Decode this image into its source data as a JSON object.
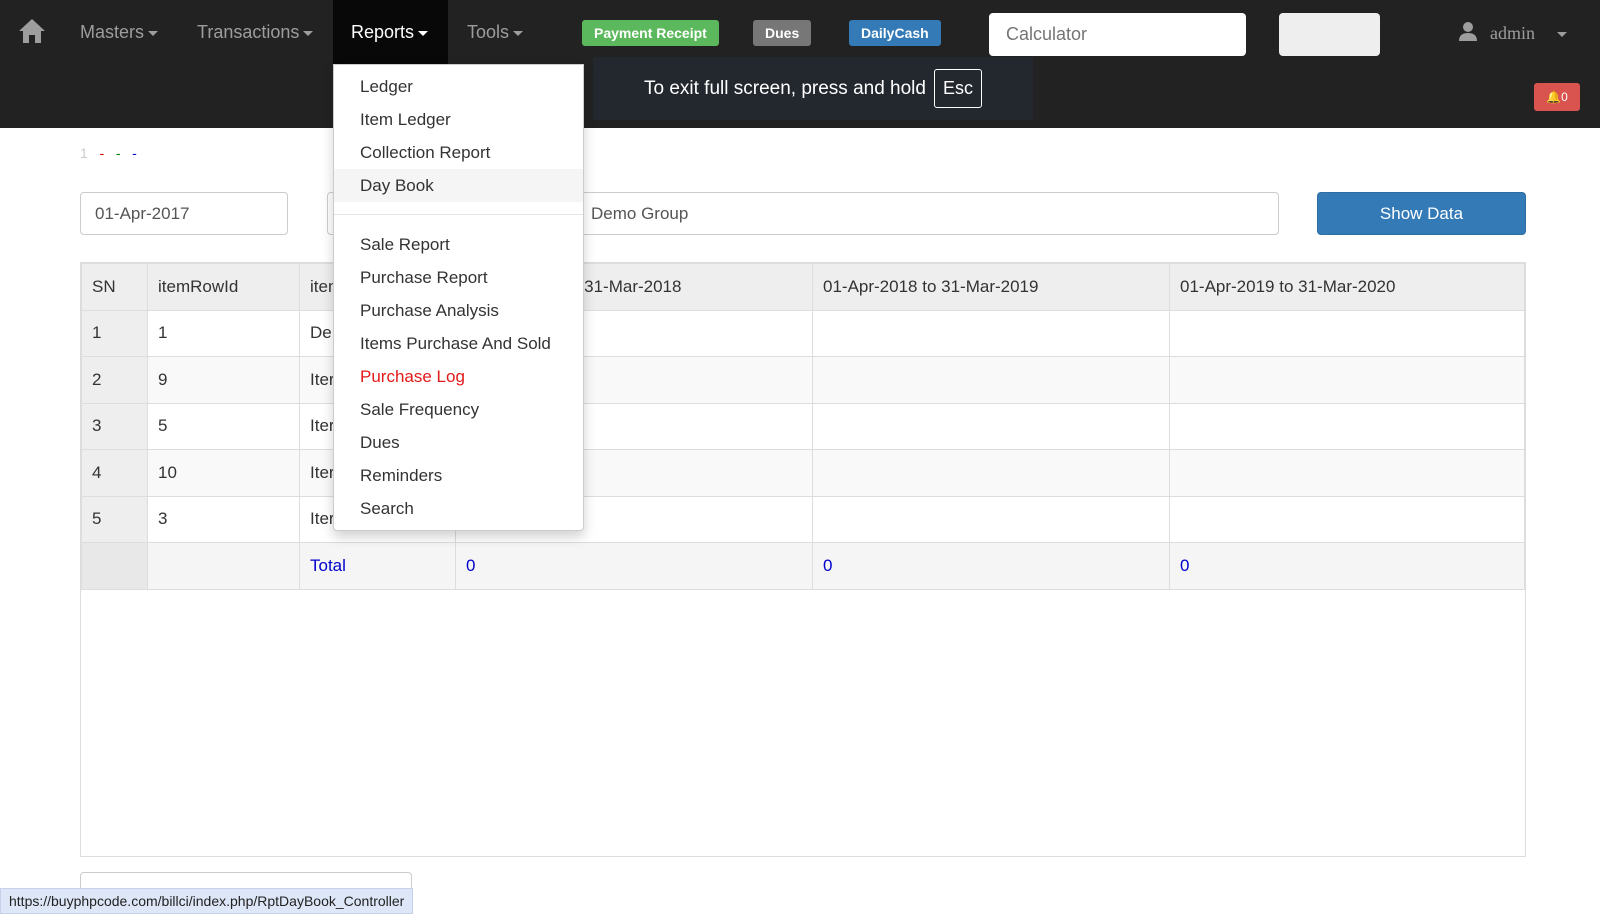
{
  "navbar": {
    "menus": [
      "Masters",
      "Transactions",
      "Reports",
      "Tools"
    ],
    "active": "Reports",
    "labels": [
      {
        "text": "Payment Receipt",
        "color": "#5cb85c"
      },
      {
        "text": "Dues",
        "color": "#777777"
      },
      {
        "text": "DailyCash",
        "color": "#337ab7"
      }
    ],
    "calculator_placeholder": "Calculator",
    "user": "admin",
    "notifications": "0"
  },
  "fullscreen_toast": {
    "text": "To exit full screen, press and hold",
    "key": "Esc"
  },
  "legend": {
    "num": "1",
    "dashes": [
      {
        "text": "-",
        "color": "#d00000"
      },
      {
        "text": "-",
        "color": "#008000"
      },
      {
        "text": "-",
        "color": "#0000cc"
      }
    ]
  },
  "filters": {
    "date": "01-Apr-2017",
    "group": "Demo Group",
    "show_button": "Show Data"
  },
  "reports_menu": {
    "group1": [
      "Ledger",
      "Item Ledger",
      "Collection Report",
      "Day Book"
    ],
    "group2": [
      "Sale Report",
      "Purchase Report",
      "Purchase Analysis",
      "Items Purchase And Sold",
      "Purchase Log",
      "Sale Frequency",
      "Dues",
      "Reminders",
      "Search"
    ],
    "hovered": "Day Book",
    "highlighted": "Purchase Log"
  },
  "table": {
    "headers": [
      "SN",
      "itemRowId",
      "item",
      "01-Apr-2017 to 31-Mar-2018",
      "01-Apr-2018 to 31-Mar-2019",
      "01-Apr-2019 to 31-Mar-2020"
    ],
    "rows": [
      [
        "1",
        "1",
        "De",
        "",
        "",
        ""
      ],
      [
        "2",
        "9",
        "Iter",
        "",
        "",
        ""
      ],
      [
        "3",
        "5",
        "Iter",
        "",
        "",
        ""
      ],
      [
        "4",
        "10",
        "Iter",
        "",
        "",
        ""
      ],
      [
        "5",
        "3",
        "Iter",
        "",
        "",
        ""
      ]
    ],
    "total": {
      "label": "Total",
      "values": [
        "0",
        "0",
        "0"
      ]
    }
  },
  "status_url": "https://buyphpcode.com/billci/index.php/RptDayBook_Controller"
}
